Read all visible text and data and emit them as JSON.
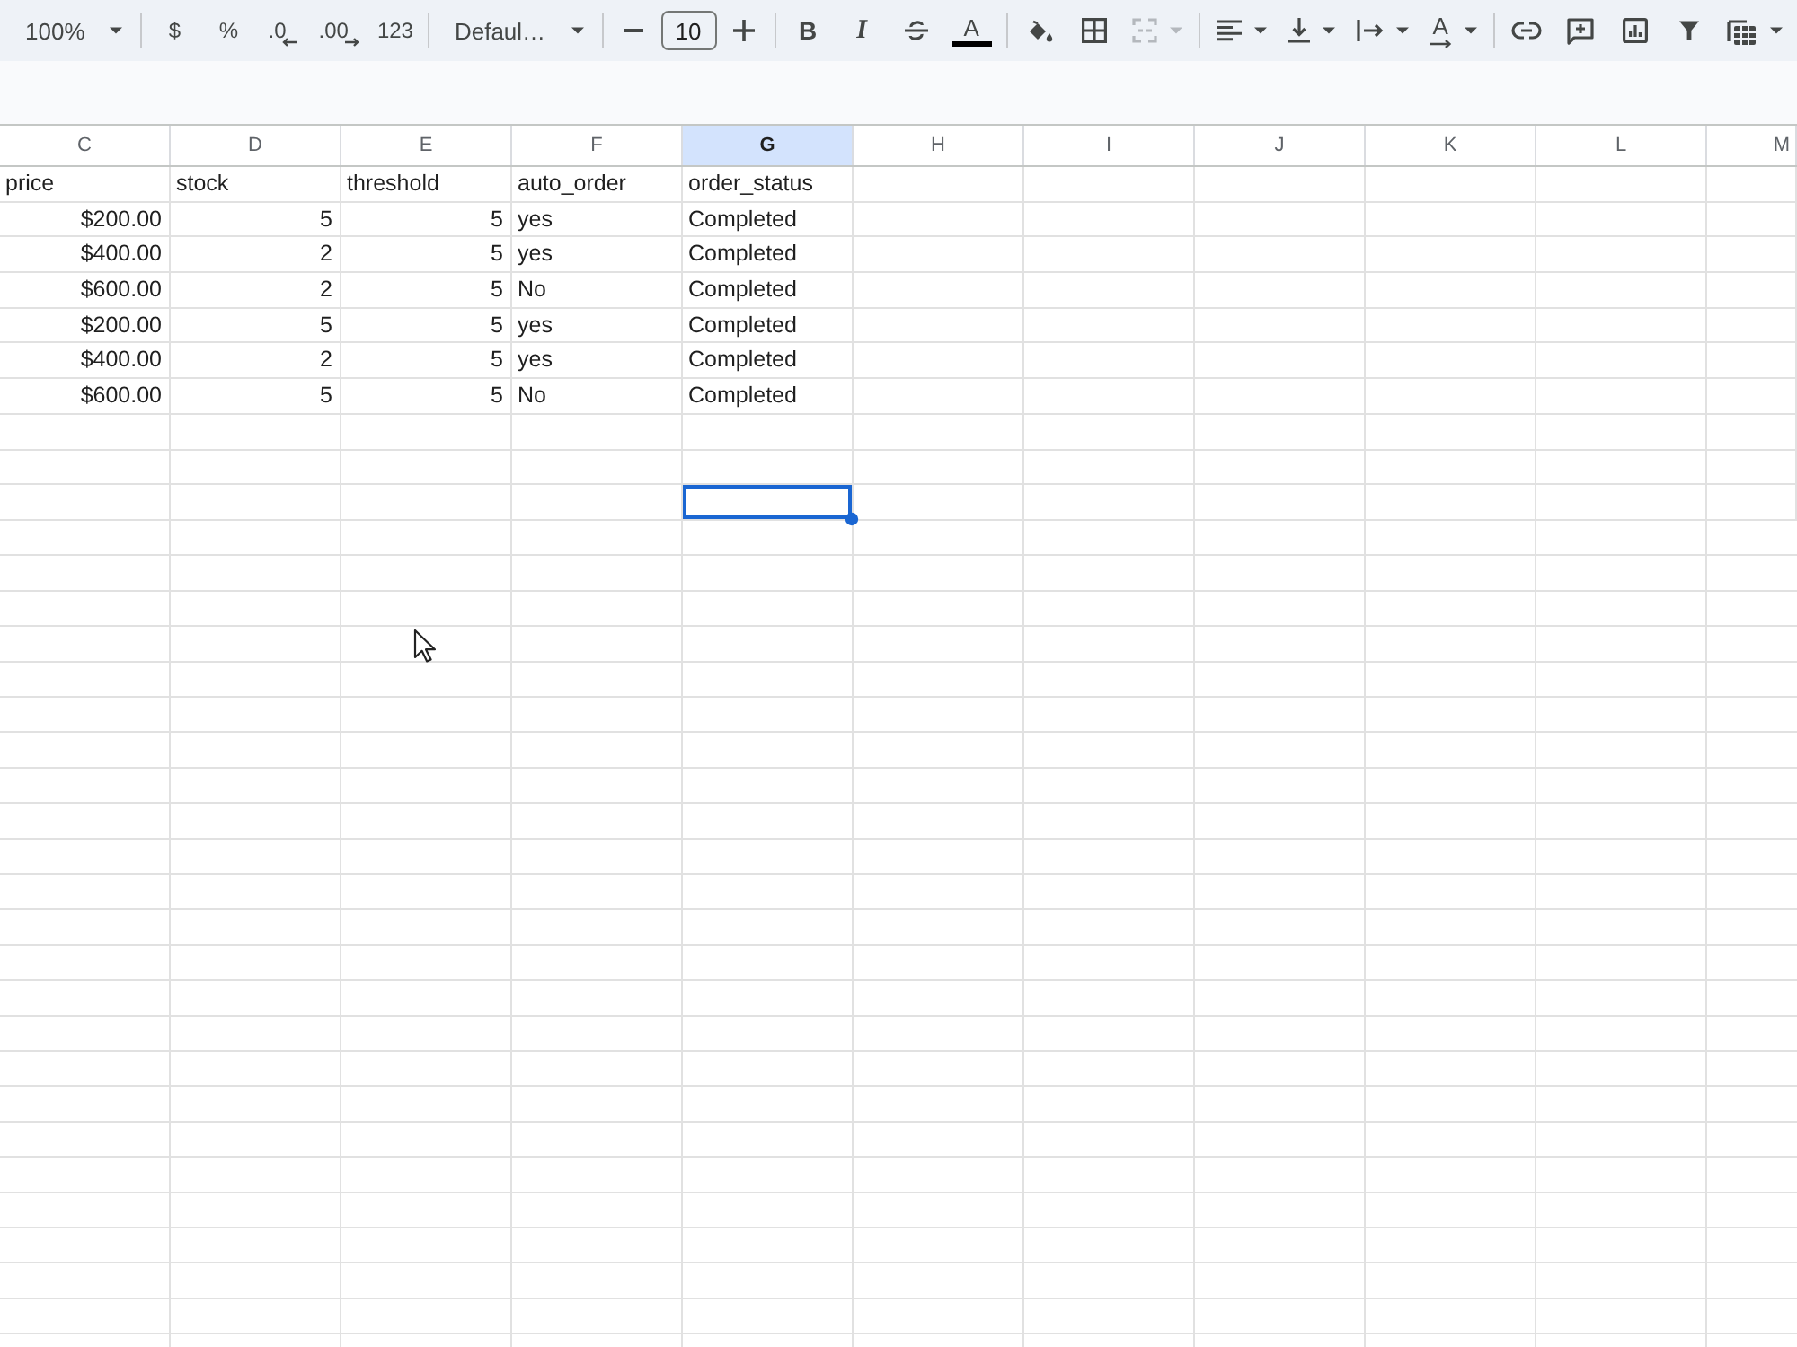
{
  "toolbar": {
    "groups": [
      {
        "items": [
          {
            "kind": "zoom",
            "label": "100%",
            "disabled": false
          }
        ]
      },
      {
        "items": [
          {
            "kind": "text",
            "label": "$",
            "disabled": false
          },
          {
            "kind": "text",
            "label": "%",
            "disabled": false
          },
          {
            "kind": "decimal_less",
            "label": ".0",
            "disabled": false
          },
          {
            "kind": "decimal_more",
            "label": ".00",
            "disabled": false
          },
          {
            "kind": "text",
            "label": "123",
            "disabled": false
          }
        ]
      },
      {
        "items": [
          {
            "kind": "font",
            "label": "Defaul…",
            "disabled": false
          }
        ]
      },
      {
        "items": [
          {
            "kind": "minus",
            "disabled": false
          },
          {
            "kind": "field",
            "value": "10",
            "disabled": false
          },
          {
            "kind": "plus",
            "disabled": false
          }
        ]
      },
      {
        "items": [
          {
            "kind": "bold",
            "label": "B",
            "disabled": false
          },
          {
            "kind": "italic",
            "label": "I",
            "disabled": false
          },
          {
            "kind": "strikethrough",
            "disabled": false
          },
          {
            "kind": "text_color",
            "label": "A",
            "disabled": false
          }
        ]
      },
      {
        "items": [
          {
            "kind": "fill_color",
            "disabled": false
          },
          {
            "kind": "borders",
            "disabled": false
          },
          {
            "kind": "merge",
            "disabled": true
          }
        ]
      },
      {
        "items": [
          {
            "kind": "align",
            "disabled": false
          },
          {
            "kind": "valign",
            "disabled": false
          },
          {
            "kind": "wrap",
            "disabled": false
          },
          {
            "kind": "rotate",
            "label": "A",
            "disabled": false
          }
        ]
      },
      {
        "items": [
          {
            "kind": "link",
            "disabled": false
          },
          {
            "kind": "comment",
            "disabled": false
          },
          {
            "kind": "chart",
            "disabled": false
          },
          {
            "kind": "filter",
            "disabled": false
          },
          {
            "kind": "functions",
            "disabled": false
          }
        ]
      }
    ]
  },
  "sheet": {
    "columns": [
      {
        "label": "C",
        "selected": false
      },
      {
        "label": "D",
        "selected": false
      },
      {
        "label": "E",
        "selected": false
      },
      {
        "label": "F",
        "selected": false
      },
      {
        "label": "G",
        "selected": true
      },
      {
        "label": "H",
        "selected": false
      },
      {
        "label": "I",
        "selected": false
      },
      {
        "label": "J",
        "selected": false
      },
      {
        "label": "K",
        "selected": false
      },
      {
        "label": "L",
        "selected": false
      },
      {
        "label": "M",
        "selected": false
      }
    ],
    "rows": [
      {
        "cells": [
          {
            "value": "price",
            "kind": "text",
            "selected": false
          },
          {
            "value": "stock",
            "kind": "text",
            "selected": false
          },
          {
            "value": "threshold",
            "kind": "text",
            "selected": false
          },
          {
            "value": "auto_order",
            "kind": "text",
            "selected": false
          },
          {
            "value": "order_status",
            "kind": "text",
            "selected": false
          },
          {
            "selected": false
          },
          {
            "selected": false
          },
          {
            "selected": false
          },
          {
            "selected": false
          },
          {
            "selected": false
          },
          {
            "selected": false
          }
        ]
      },
      {
        "cells": [
          {
            "value": "$200.00",
            "kind": "number",
            "selected": false
          },
          {
            "value": "5",
            "kind": "number",
            "selected": false
          },
          {
            "value": "5",
            "kind": "number",
            "selected": false
          },
          {
            "value": "yes",
            "kind": "text",
            "selected": false
          },
          {
            "value": "Completed",
            "kind": "text",
            "selected": false
          },
          {
            "selected": false
          },
          {
            "selected": false
          },
          {
            "selected": false
          },
          {
            "selected": false
          },
          {
            "selected": false
          },
          {
            "selected": false
          }
        ]
      },
      {
        "cells": [
          {
            "value": "$400.00",
            "kind": "number",
            "selected": false
          },
          {
            "value": "2",
            "kind": "number",
            "selected": false
          },
          {
            "value": "5",
            "kind": "number",
            "selected": false
          },
          {
            "value": "yes",
            "kind": "text",
            "selected": false
          },
          {
            "value": "Completed",
            "kind": "text",
            "selected": false
          },
          {
            "selected": false
          },
          {
            "selected": false
          },
          {
            "selected": false
          },
          {
            "selected": false
          },
          {
            "selected": false
          },
          {
            "selected": false
          }
        ]
      },
      {
        "cells": [
          {
            "value": "$600.00",
            "kind": "number",
            "selected": false
          },
          {
            "value": "2",
            "kind": "number",
            "selected": false
          },
          {
            "value": "5",
            "kind": "number",
            "selected": false
          },
          {
            "value": "No",
            "kind": "text",
            "selected": false
          },
          {
            "value": "Completed",
            "kind": "text",
            "selected": false
          },
          {
            "selected": false
          },
          {
            "selected": false
          },
          {
            "selected": false
          },
          {
            "selected": false
          },
          {
            "selected": false
          },
          {
            "selected": false
          }
        ]
      },
      {
        "cells": [
          {
            "value": "$200.00",
            "kind": "number",
            "selected": false
          },
          {
            "value": "5",
            "kind": "number",
            "selected": false
          },
          {
            "value": "5",
            "kind": "number",
            "selected": false
          },
          {
            "value": "yes",
            "kind": "text",
            "selected": false
          },
          {
            "value": "Completed",
            "kind": "text",
            "selected": false
          },
          {
            "selected": false
          },
          {
            "selected": false
          },
          {
            "selected": false
          },
          {
            "selected": false
          },
          {
            "selected": false
          },
          {
            "selected": false
          }
        ]
      },
      {
        "cells": [
          {
            "value": "$400.00",
            "kind": "number",
            "selected": false
          },
          {
            "value": "2",
            "kind": "number",
            "selected": false
          },
          {
            "value": "5",
            "kind": "number",
            "selected": false
          },
          {
            "value": "yes",
            "kind": "text",
            "selected": false
          },
          {
            "value": "Completed",
            "kind": "text",
            "selected": false
          },
          {
            "selected": false
          },
          {
            "selected": false
          },
          {
            "selected": false
          },
          {
            "selected": false
          },
          {
            "selected": false
          },
          {
            "selected": false
          }
        ]
      },
      {
        "cells": [
          {
            "value": "$600.00",
            "kind": "number",
            "selected": false
          },
          {
            "value": "5",
            "kind": "number",
            "selected": false
          },
          {
            "value": "5",
            "kind": "number",
            "selected": false
          },
          {
            "value": "No",
            "kind": "text",
            "selected": false
          },
          {
            "value": "Completed",
            "kind": "text",
            "selected": false
          },
          {
            "selected": false
          },
          {
            "selected": false
          },
          {
            "selected": false
          },
          {
            "selected": false
          },
          {
            "selected": false
          },
          {
            "selected": false
          }
        ]
      },
      {
        "cells": [
          {
            "selected": false
          },
          {
            "selected": false
          },
          {
            "selected": false
          },
          {
            "selected": false
          },
          {
            "selected": false
          },
          {
            "selected": false
          },
          {
            "selected": false
          },
          {
            "selected": false
          },
          {
            "selected": false
          },
          {
            "selected": false
          },
          {
            "selected": false
          }
        ]
      },
      {
        "cells": [
          {
            "selected": false
          },
          {
            "selected": false
          },
          {
            "selected": false
          },
          {
            "selected": false
          },
          {
            "selected": false
          },
          {
            "selected": false
          },
          {
            "selected": false
          },
          {
            "selected": false
          },
          {
            "selected": false
          },
          {
            "selected": false
          },
          {
            "selected": false
          }
        ]
      },
      {
        "cells": [
          {
            "selected": false
          },
          {
            "selected": false
          },
          {
            "selected": false
          },
          {
            "selected": false
          },
          {
            "selected": true
          },
          {
            "selected": false
          },
          {
            "selected": false
          },
          {
            "selected": false
          },
          {
            "selected": false
          },
          {
            "selected": false
          },
          {
            "selected": false
          }
        ]
      }
    ]
  }
}
